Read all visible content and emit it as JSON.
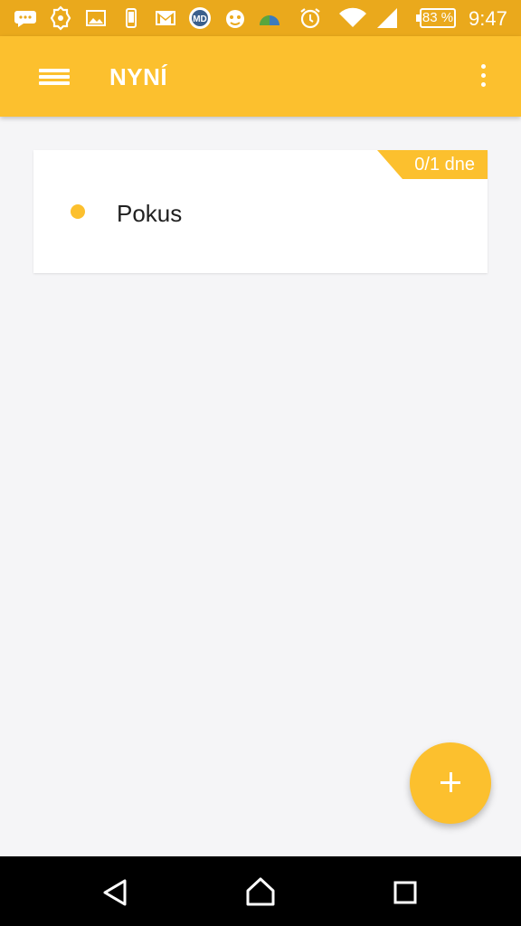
{
  "status_bar": {
    "icons": [
      "chat-icon",
      "badge-notification-icon",
      "image-icon",
      "phone-sms-icon",
      "gmail-icon",
      "md-app-icon",
      "mascot-app-icon",
      "weather-icon",
      "alarm-icon",
      "wifi-icon",
      "cellular-signal-icon"
    ],
    "battery": "83 %",
    "time": "9:47"
  },
  "app_bar": {
    "title": "NYNÍ",
    "menu_icon": "hamburger-menu-icon",
    "overflow_icon": "more-vert-icon"
  },
  "tasks": [
    {
      "title": "Pokus",
      "badge": "0/1 dne"
    }
  ],
  "fab": {
    "icon": "plus-icon"
  },
  "nav_bar": {
    "icons": [
      "back-icon",
      "home-icon",
      "recents-icon"
    ]
  },
  "colors": {
    "accent": "#fcc02e",
    "status_bar": "#eaa91c",
    "background": "#f5f5f7"
  }
}
